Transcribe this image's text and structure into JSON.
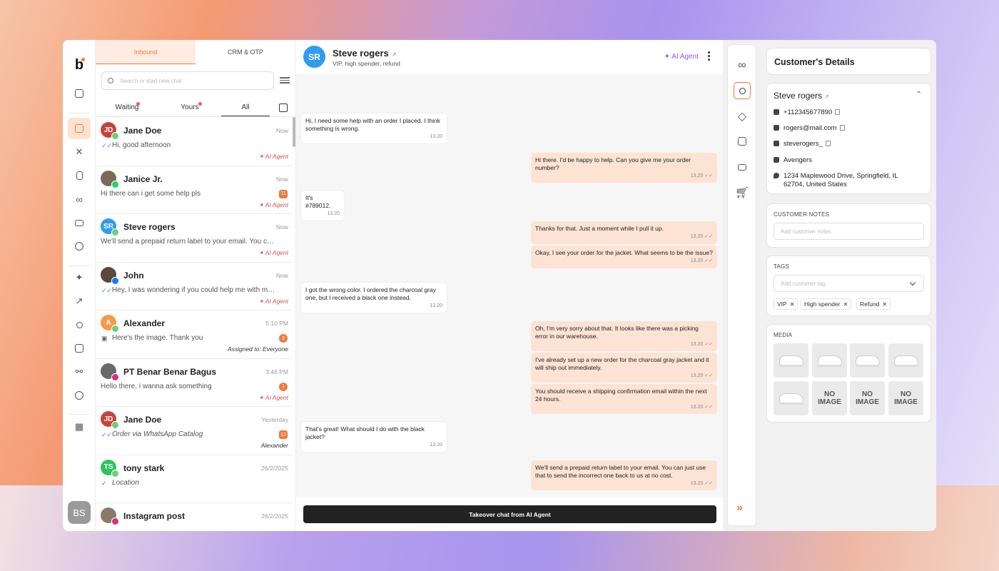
{
  "nav": {
    "logo": "b",
    "avatar_initials": "BS"
  },
  "list": {
    "tabs": [
      "Inbound",
      "CRM & OTP"
    ],
    "search_placeholder": "Search or start new chat",
    "subtabs": [
      "Waiting",
      "Yours",
      "All"
    ],
    "rows": [
      {
        "initials": "JD",
        "name": "Jane Doe",
        "time": "Now",
        "preview": "Hi, good afternoon",
        "tag": "AI Agent",
        "color": "#c8443a",
        "channel": "#6ad07a",
        "count": ""
      },
      {
        "initials": "",
        "name": "Janice Jr.",
        "time": "Now",
        "preview": "Hi there can i get some help pls",
        "tag": "AI Agent",
        "color": "#7a6a5a",
        "channel": "#25d366",
        "count": "11"
      },
      {
        "initials": "SR",
        "name": "Steve rogers",
        "time": "Now",
        "preview": "We'll send a prepaid return label to your email. You can just use that to send the incorrect one back",
        "tag": "AI Agent",
        "color": "#2f9cf0",
        "channel": "#6ad07a",
        "count": ""
      },
      {
        "initials": "",
        "name": "John",
        "time": "Now",
        "preview": "Hey, I was wondering if you could help me with my order",
        "tag": "AI Agent",
        "color": "#5a4a3a",
        "channel": "#1877f2",
        "count": ""
      },
      {
        "initials": "A",
        "name": "Alexander",
        "time": "5:10 PM",
        "preview": "Here's the image. Thank you",
        "tag": "Assigned to: Everyone",
        "color": "#f59a4a",
        "channel": "#6ad07a",
        "count": "3"
      },
      {
        "initials": "",
        "name": "PT Benar Benar Bagus",
        "time": "3:46 PM",
        "preview": "Hello there, i wanna ask something",
        "tag": "AI Agent",
        "color": "#6a6a6a",
        "channel": "#d6317a",
        "count": "1"
      },
      {
        "initials": "JD",
        "name": "Jane Doe",
        "time": "Yesterday",
        "preview": "Order via WhatsApp Catalog",
        "tag": "Alexander",
        "color": "#c8443a",
        "channel": "#6ad07a",
        "count": "12"
      },
      {
        "initials": "TS",
        "name": "tony stark",
        "time": "26/2/2025",
        "preview": "Location",
        "tag": "",
        "color": "#2ec45a",
        "channel": "#6ad07a",
        "count": ""
      },
      {
        "initials": "",
        "name": "Instagram post",
        "time": "26/2/2025",
        "preview": "",
        "tag": "",
        "color": "#8a7a6a",
        "channel": "#d6317a",
        "count": ""
      }
    ]
  },
  "conversation": {
    "initials": "SR",
    "name": "Steve rogers",
    "subtitle": "VIP, high spender, refund",
    "agent_label": "AI Agent",
    "takeover_label": "Takeover chat from AI Agent",
    "messages": [
      {
        "dir": "in",
        "text": "Hi, I need some help with an order I placed. I think something is wrong.",
        "time": "13.20"
      },
      {
        "dir": "out",
        "text": "Hi there. I'd be happy to help. Can you give me your order number?",
        "time": "13.20"
      },
      {
        "dir": "in",
        "text": "It's #789012.",
        "time": "13.20"
      },
      {
        "dir": "out",
        "text": "Thanks for that. Just a moment while I pull it up.",
        "time": "13.20"
      },
      {
        "dir": "out",
        "text": "Okay, I see your order for the jacket. What seems to be the issue?",
        "time": "13.20"
      },
      {
        "dir": "in",
        "text": "I got the wrong color. I ordered the charcoal gray one, but I received a black one instead.",
        "time": "13.20"
      },
      {
        "dir": "out",
        "text": "Oh, I'm very sorry about that. It looks like there was a picking error in our warehouse.",
        "time": "13.20"
      },
      {
        "dir": "out",
        "text": "I've already set up a new order for the charcoal gray jacket and it will ship out immediately.",
        "time": "13.20"
      },
      {
        "dir": "out",
        "text": "You should receive a shipping confirmation email within the next 24 hours.",
        "time": "13.20"
      },
      {
        "dir": "in",
        "text": "That's great! What should I do with the black jacket?",
        "time": "13.20"
      },
      {
        "dir": "out",
        "text": "We'll send a prepaid return label to your email. You can just use that to send the incorrect one back to us at no cost.",
        "time": "13.20"
      }
    ]
  },
  "details": {
    "title": "Customer's Details",
    "name": "Steve rogers",
    "phone": "+112345677890",
    "email": "rogers@mail.com",
    "instagram": "steverogers_",
    "company": "Avengers",
    "address": "1234 Maplewood Drive, Springfield, IL 62704, United States",
    "notes_title": "CUSTOMER NOTES",
    "notes_placeholder": "Add customer notes",
    "tags_title": "TAGS",
    "tags_placeholder": "Add customer tag",
    "tags": [
      "VIP",
      "High spender",
      "Refund"
    ],
    "media_title": "MEDIA",
    "no_image": "NO IMAGE"
  }
}
